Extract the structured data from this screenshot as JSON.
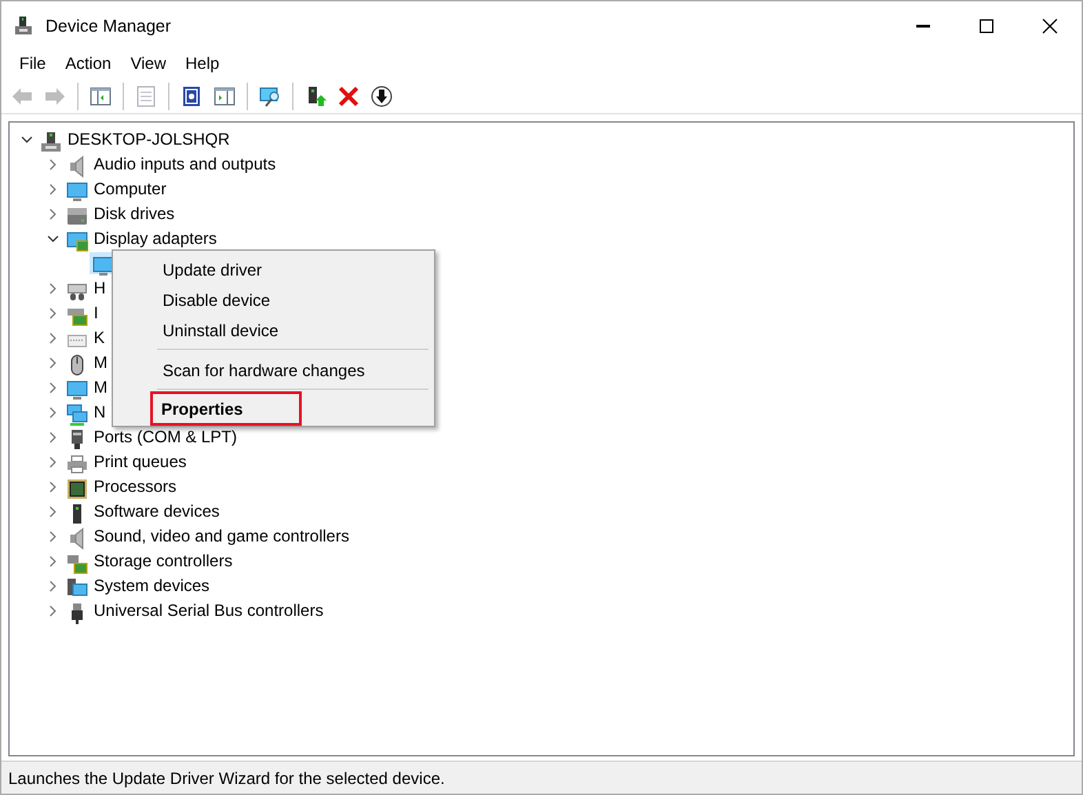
{
  "window": {
    "title": "Device Manager"
  },
  "menu_bar": [
    "File",
    "Action",
    "View",
    "Help"
  ],
  "toolbar": [
    {
      "kind": "back",
      "disabled": true
    },
    {
      "kind": "forward",
      "disabled": true
    },
    {
      "kind": "separator"
    },
    {
      "kind": "console-tree",
      "disabled": false
    },
    {
      "kind": "separator"
    },
    {
      "kind": "properties",
      "disabled": true
    },
    {
      "kind": "separator"
    },
    {
      "kind": "help",
      "disabled": false
    },
    {
      "kind": "action-pane",
      "disabled": false
    },
    {
      "kind": "separator"
    },
    {
      "kind": "scan",
      "disabled": false
    },
    {
      "kind": "separator"
    },
    {
      "kind": "update-driver",
      "disabled": false
    },
    {
      "kind": "uninstall",
      "disabled": false
    },
    {
      "kind": "disable",
      "disabled": false
    }
  ],
  "tree": {
    "label": "DESKTOP-JOLSHQR",
    "kind": "computer",
    "expanded": true,
    "children": [
      {
        "label": "Audio inputs and outputs",
        "kind": "speaker",
        "expanded": false
      },
      {
        "label": "Computer",
        "kind": "monitor",
        "expanded": false
      },
      {
        "label": "Disk drives",
        "kind": "disk",
        "expanded": false
      },
      {
        "label": "Display adapters",
        "kind": "display",
        "expanded": true,
        "children": [
          {
            "kind": "monitor",
            "selected": true
          }
        ]
      },
      {
        "label": "H",
        "kind": "hid",
        "expanded": false
      },
      {
        "label": "I",
        "kind": "card",
        "expanded": false
      },
      {
        "label": "K",
        "kind": "keyboard",
        "expanded": false
      },
      {
        "label": "M",
        "kind": "mouse",
        "expanded": false
      },
      {
        "label": "M",
        "kind": "monitor",
        "expanded": false
      },
      {
        "label": "N",
        "kind": "network",
        "expanded": false
      },
      {
        "label": "Ports (COM & LPT)",
        "kind": "port",
        "expanded": false
      },
      {
        "label": "Print queues",
        "kind": "printer",
        "expanded": false
      },
      {
        "label": "Processors",
        "kind": "chip",
        "expanded": false
      },
      {
        "label": "Software devices",
        "kind": "tower",
        "expanded": false
      },
      {
        "label": "Sound, video and game controllers",
        "kind": "speaker",
        "expanded": false
      },
      {
        "label": "Storage controllers",
        "kind": "storage",
        "expanded": false
      },
      {
        "label": "System devices",
        "kind": "system",
        "expanded": false
      },
      {
        "label": "Universal Serial Bus controllers",
        "kind": "usb",
        "expanded": false
      }
    ]
  },
  "context_menu": [
    {
      "kind": "item",
      "label": "Update driver",
      "default": false,
      "highlighted": false
    },
    {
      "kind": "item",
      "label": "Disable device",
      "default": false,
      "highlighted": false
    },
    {
      "kind": "item",
      "label": "Uninstall device",
      "default": false,
      "highlighted": false
    },
    {
      "kind": "separator"
    },
    {
      "kind": "item",
      "label": "Scan for hardware changes",
      "default": false,
      "highlighted": false
    },
    {
      "kind": "separator"
    },
    {
      "kind": "item",
      "label": "Properties",
      "default": true,
      "highlighted": true
    }
  ],
  "status_bar": "Launches the Update Driver Wizard for the selected device."
}
